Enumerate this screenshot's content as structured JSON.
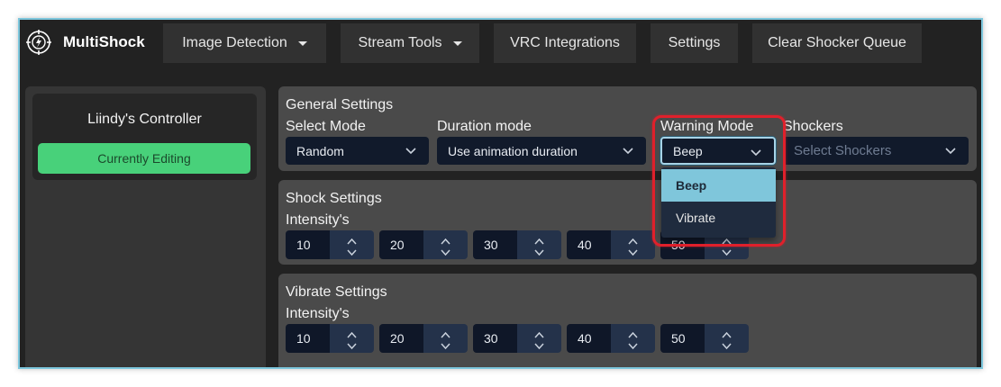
{
  "app": {
    "name": "MultiShock"
  },
  "nav": {
    "items": [
      {
        "label": "Image Detection",
        "has_caret": true
      },
      {
        "label": "Stream Tools",
        "has_caret": true
      },
      {
        "label": "VRC Integrations",
        "has_caret": false
      },
      {
        "label": "Settings",
        "has_caret": false
      },
      {
        "label": "Clear Shocker Queue",
        "has_caret": false
      }
    ]
  },
  "sidebar": {
    "controller_title": "Liindy's Controller",
    "status_button": "Currently Editing"
  },
  "general": {
    "title": "General Settings",
    "select_mode": {
      "label": "Select Mode",
      "value": "Random"
    },
    "duration_mode": {
      "label": "Duration mode",
      "value": "Use animation duration"
    },
    "warning_mode": {
      "label": "Warning Mode",
      "value": "Beep",
      "options": [
        "Beep",
        "Vibrate"
      ]
    },
    "shockers": {
      "label": "Shockers",
      "placeholder": "Select Shockers"
    }
  },
  "shock": {
    "title": "Shock Settings",
    "intensity_label": "Intensity's",
    "values": [
      "10",
      "20",
      "30",
      "40",
      "50"
    ]
  },
  "vibrate": {
    "title": "Vibrate Settings",
    "intensity_label": "Intensity's",
    "values": [
      "10",
      "20",
      "30",
      "40",
      "50"
    ]
  },
  "colors": {
    "background": "#222222",
    "panel": "#4a4a4a",
    "accent_green": "#48d17a",
    "input_bg": "#111a2b",
    "dropdown_selected": "#7fc6db",
    "highlight": "#e0202b"
  }
}
